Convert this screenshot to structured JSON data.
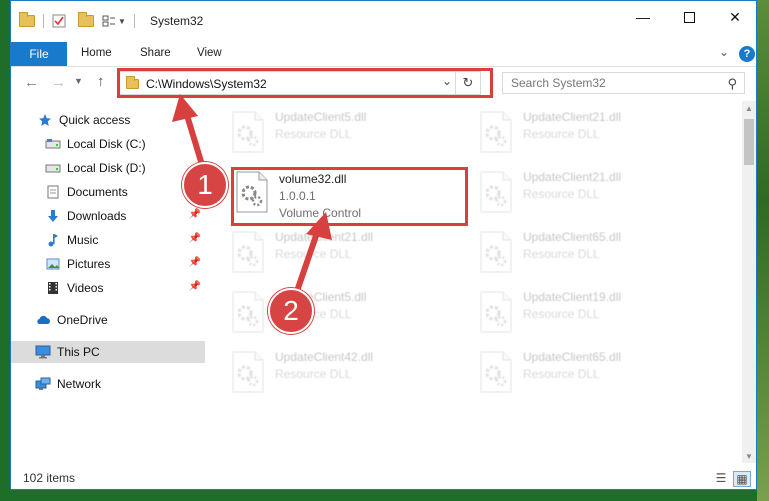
{
  "window": {
    "title": "System32"
  },
  "ribbon": {
    "file": "File",
    "home": "Home",
    "share": "Share",
    "view": "View"
  },
  "address": {
    "path": "C:\\Windows\\System32"
  },
  "search": {
    "placeholder": "Search System32"
  },
  "nav": {
    "items": [
      {
        "label": "Quick access",
        "icon": "star-icon",
        "pinned": false
      },
      {
        "label": "Local Disk (C:)",
        "icon": "drive-icon",
        "pinned": false
      },
      {
        "label": "Local Disk (D:)",
        "icon": "drive-icon",
        "pinned": false
      },
      {
        "label": "Documents",
        "icon": "documents-icon",
        "pinned": false
      },
      {
        "label": "Downloads",
        "icon": "downloads-icon",
        "pinned": true
      },
      {
        "label": "Music",
        "icon": "music-icon",
        "pinned": true
      },
      {
        "label": "Pictures",
        "icon": "pictures-icon",
        "pinned": true
      },
      {
        "label": "Videos",
        "icon": "videos-icon",
        "pinned": true
      },
      {
        "label": "OneDrive",
        "icon": "cloud-icon",
        "pinned": false
      },
      {
        "label": "This PC",
        "icon": "computer-icon",
        "pinned": false,
        "selected": true
      },
      {
        "label": "Network",
        "icon": "network-icon",
        "pinned": false
      }
    ]
  },
  "files": {
    "left": [
      {
        "name": "UpdateClient5.dll",
        "type": "Resource DLL"
      },
      {
        "name": "volume32.dll",
        "version": "1.0.0.1",
        "description": "Volume Control"
      },
      {
        "name": "UpdateClient21.dll",
        "type": "Resource DLL"
      },
      {
        "name": "UpdateClient5.dll",
        "type": "Resource DLL"
      },
      {
        "name": "UpdateClient42.dll",
        "type": "Resource DLL"
      }
    ],
    "right": [
      {
        "name": "UpdateClient21.dll",
        "type": "Resource DLL"
      },
      {
        "name": "UpdateClient21.dll",
        "type": "Resource DLL"
      },
      {
        "name": "UpdateClient65.dll",
        "type": "Resource DLL"
      },
      {
        "name": "UpdateClient19.dll",
        "type": "Resource DLL"
      },
      {
        "name": "UpdateClient65.dll",
        "type": "Resource DLL"
      }
    ]
  },
  "status": {
    "count": "102 items"
  },
  "annotations": {
    "step1": "1",
    "step2": "2"
  },
  "colors": {
    "accent": "#1979ca",
    "annotation": "#d84040"
  }
}
